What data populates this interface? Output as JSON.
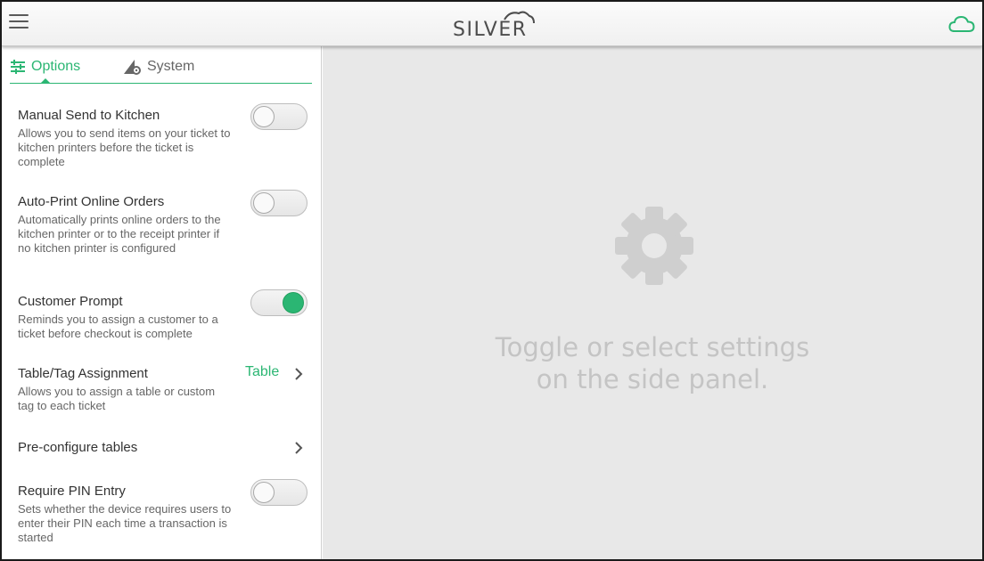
{
  "app": {
    "logo_text": "SILVER",
    "accent_color": "#2bb673",
    "menu_icon": "hamburger-menu-icon",
    "status_icon": "cloud-icon"
  },
  "tabs": [
    {
      "label": "Options",
      "icon": "sliders-icon",
      "active": true
    },
    {
      "label": "System",
      "icon": "system-settings-icon",
      "active": false
    }
  ],
  "settings": [
    {
      "title": "Manual Send to Kitchen",
      "description": "Allows you to send items on your ticket to kitchen printers before the ticket is complete",
      "control": "toggle",
      "on": false
    },
    {
      "title": "Auto-Print Online Orders",
      "description": "Automatically prints online orders to the kitchen printer or to the receipt printer if no kitchen printer is configured",
      "control": "toggle",
      "on": false
    },
    {
      "title": "Customer Prompt",
      "description": "Reminds you to assign a customer to a ticket before checkout is complete",
      "control": "toggle",
      "on": true
    },
    {
      "title": "Table/Tag Assignment",
      "description": "Allows you to assign a table or custom tag to each ticket",
      "control": "link",
      "value": "Table"
    },
    {
      "title": "Pre-configure tables",
      "description": "",
      "control": "link"
    },
    {
      "title": "Require PIN Entry",
      "description": "Sets whether the device requires users to enter their PIN each time a transaction is started",
      "control": "toggle",
      "on": false
    }
  ],
  "main": {
    "icon": "gear-icon",
    "placeholder_line1": "Toggle or select settings",
    "placeholder_line2": "on the side panel."
  }
}
